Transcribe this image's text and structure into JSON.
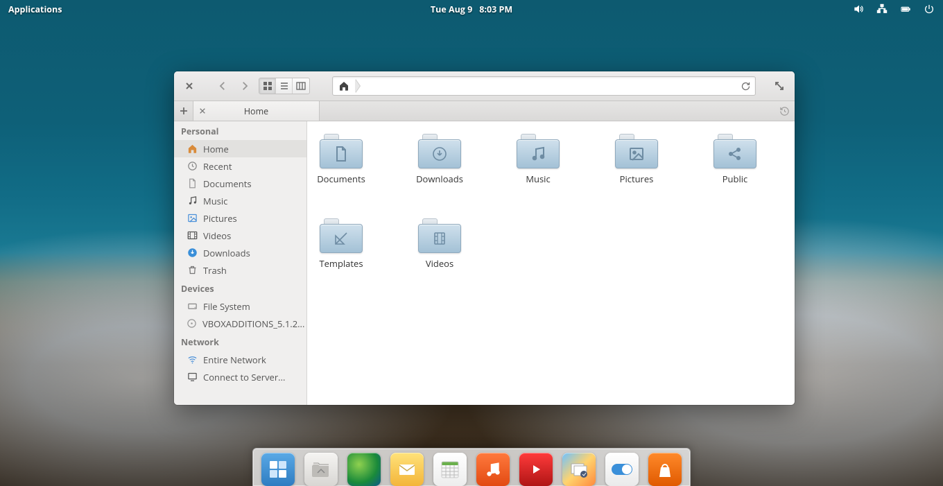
{
  "panel": {
    "applications": "Applications",
    "date": "Tue Aug  9",
    "time": "8:03 PM"
  },
  "fm": {
    "tab_label": "Home",
    "sidebar": {
      "personal_head": "Personal",
      "devices_head": "Devices",
      "network_head": "Network",
      "personal": [
        {
          "label": "Home",
          "icon": "home"
        },
        {
          "label": "Recent",
          "icon": "clock"
        },
        {
          "label": "Documents",
          "icon": "doc"
        },
        {
          "label": "Music",
          "icon": "music"
        },
        {
          "label": "Pictures",
          "icon": "image"
        },
        {
          "label": "Videos",
          "icon": "video"
        },
        {
          "label": "Downloads",
          "icon": "download"
        },
        {
          "label": "Trash",
          "icon": "trash"
        }
      ],
      "devices": [
        {
          "label": "File System",
          "icon": "drive"
        },
        {
          "label": "VBOXADDITIONS_5.1.2...",
          "icon": "disc"
        }
      ],
      "network": [
        {
          "label": "Entire Network",
          "icon": "wifi"
        },
        {
          "label": "Connect to Server...",
          "icon": "screen"
        }
      ]
    },
    "folders": [
      {
        "label": "Documents",
        "glyph": "doc"
      },
      {
        "label": "Downloads",
        "glyph": "download"
      },
      {
        "label": "Music",
        "glyph": "music"
      },
      {
        "label": "Pictures",
        "glyph": "image"
      },
      {
        "label": "Public",
        "glyph": "share"
      },
      {
        "label": "Templates",
        "glyph": "ruler"
      },
      {
        "label": "Videos",
        "glyph": "film"
      }
    ]
  },
  "dock": [
    {
      "name": "multitask",
      "bg": "linear-gradient(#5aa9e6,#2e7cc1)"
    },
    {
      "name": "files",
      "bg": "linear-gradient(#f5f4f2,#d8d6d3)",
      "active": true
    },
    {
      "name": "browser",
      "bg": "radial-gradient(circle at 35% 35%,#8fd14f,#1a8a3a 60%,#0c5a8a)"
    },
    {
      "name": "mail",
      "bg": "linear-gradient(#ffe27a,#f3b53a)"
    },
    {
      "name": "calendar",
      "bg": "linear-gradient(#ffffff,#ededed)"
    },
    {
      "name": "music",
      "bg": "linear-gradient(#ff7a3d,#e24a12)"
    },
    {
      "name": "videos",
      "bg": "linear-gradient(#ff3b3b,#b01515)"
    },
    {
      "name": "photos",
      "bg": "linear-gradient(135deg,#6ec1ff,#ffd36e 50%,#ff8a3d)"
    },
    {
      "name": "settings",
      "bg": "linear-gradient(#ffffff,#eaeaea)"
    },
    {
      "name": "appcenter",
      "bg": "linear-gradient(#ff8a2a,#e05a00)"
    }
  ]
}
